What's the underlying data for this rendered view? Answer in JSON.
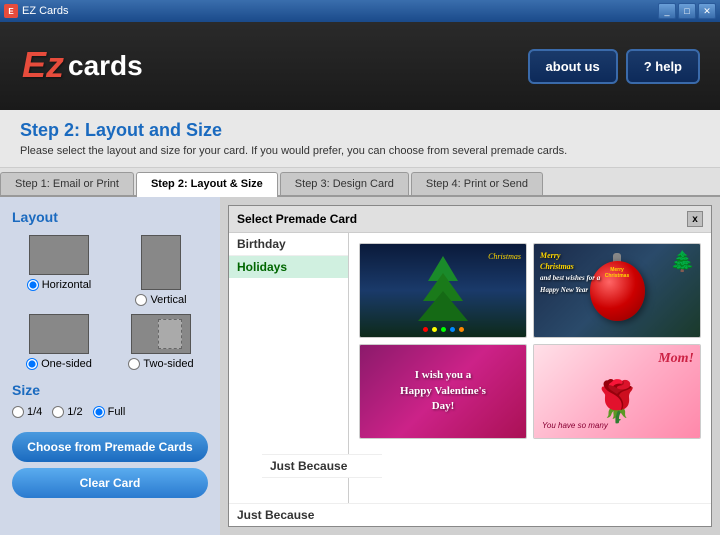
{
  "window": {
    "title": "EZ Cards"
  },
  "header": {
    "logo_ez": "EZ",
    "logo_cards": "cards",
    "btn_about": "about us",
    "btn_help": "? help"
  },
  "page": {
    "title": "Step 2: Layout and Size",
    "subtitle": "Please select the layout and size for your card. If you would prefer, you can choose from several premade cards."
  },
  "tabs": [
    {
      "label": "Step 1: Email or Print",
      "active": false
    },
    {
      "label": "Step 2: Layout & Size",
      "active": true
    },
    {
      "label": "Step 3: Design Card",
      "active": false
    },
    {
      "label": "Step 4: Print or Send",
      "active": false
    }
  ],
  "left_panel": {
    "layout_label": "Layout",
    "layout_options": [
      {
        "label": "Horizontal",
        "type": "horizontal",
        "selected": true
      },
      {
        "label": "Vertical",
        "type": "vertical",
        "selected": false
      },
      {
        "label": "One-sided",
        "type": "one-sided",
        "selected": true
      },
      {
        "label": "Two-sided",
        "type": "two-sided",
        "selected": false
      }
    ],
    "size_label": "Size",
    "size_options": [
      {
        "label": "1/4",
        "selected": false
      },
      {
        "label": "1/2",
        "selected": false
      },
      {
        "label": "Full",
        "selected": true
      }
    ],
    "btn_premade": "Choose from Premade Cards",
    "btn_clear": "Clear Card"
  },
  "premade_dialog": {
    "title": "Select Premade Card",
    "close": "x",
    "categories": [
      {
        "label": "Birthday",
        "selected": false
      },
      {
        "label": "Holidays",
        "selected": true
      },
      {
        "label": "Just Because",
        "selected": false
      }
    ],
    "cards": [
      {
        "type": "christmas-tree",
        "alt": "Christmas Tree card"
      },
      {
        "type": "ornament",
        "alt": "Merry Christmas ornament card"
      },
      {
        "type": "valentine",
        "alt": "Valentine's Day card"
      },
      {
        "type": "mom",
        "alt": "Mom roses card"
      }
    ]
  }
}
